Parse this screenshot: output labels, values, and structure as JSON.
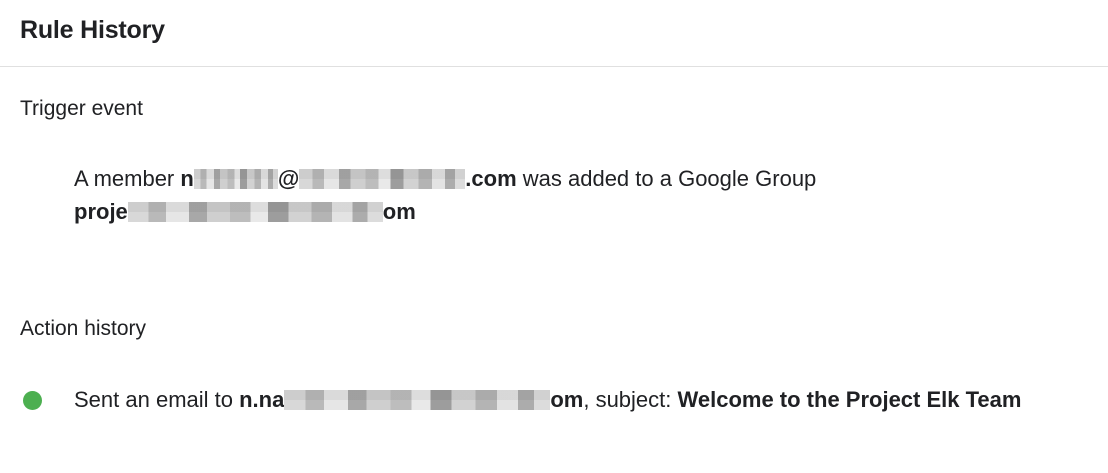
{
  "header": {
    "title": "Rule History"
  },
  "trigger": {
    "heading": "Trigger event",
    "prefix": "A member ",
    "member_start": "n",
    "member_at": "@",
    "member_end": ".com",
    "middle": " was added to a Google Group ",
    "group_start": "proje",
    "group_end": "om"
  },
  "actions": {
    "heading": "Action history",
    "items": [
      {
        "status": "success",
        "status_color": "#4caf50",
        "prefix": "Sent an email to ",
        "recipient_start": "n.na",
        "recipient_end": "om",
        "middle": ", subject: ",
        "subject": "Welcome to the Project Elk Team"
      }
    ]
  }
}
